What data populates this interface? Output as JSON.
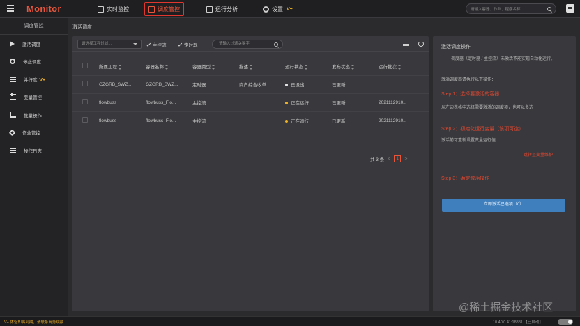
{
  "app": {
    "title": "Monitor"
  },
  "topnav": {
    "items": [
      {
        "label": "实时监控",
        "active": false
      },
      {
        "label": "调度管控",
        "active": true
      },
      {
        "label": "运行分析",
        "active": false
      },
      {
        "label": "设置",
        "badge": "V+",
        "active": false
      }
    ],
    "search_placeholder": "请输入容器、作业、程序名称"
  },
  "sidebar": {
    "title": "调度管控",
    "items": [
      {
        "label": "激活调度",
        "icon": "play-icon"
      },
      {
        "label": "停止调度",
        "icon": "stop-icon"
      },
      {
        "label": "并行度",
        "badge": "V+",
        "icon": "parallel-icon"
      },
      {
        "label": "变量管控",
        "icon": "sliders-icon"
      },
      {
        "label": "批量操作",
        "icon": "batch-icon"
      },
      {
        "label": "作业管控",
        "icon": "tool-icon"
      },
      {
        "label": "操作日志",
        "icon": "log-icon"
      }
    ]
  },
  "main": {
    "breadcrumb": "激活调度",
    "filters": {
      "project_select_placeholder": "请选择工程过滤...",
      "check_main": "主控流",
      "check_timer": "定时器",
      "keyword_placeholder": "请输入过滤关键字"
    },
    "table": {
      "columns": [
        "所属工程",
        "容器名称",
        "容器类型",
        "描述",
        "运行状态",
        "发布状态",
        "运行批次"
      ],
      "rows": [
        {
          "project": "GZGRB_SWZ...",
          "container": "GZGRB_SWZ...",
          "type": "定时器",
          "desc": "商户综合收单...",
          "run_state": "已退出",
          "run_color": "#e6e6e6",
          "publish": "已更新",
          "batch": ""
        },
        {
          "project": "flowbuss",
          "container": "flowbuss_Flo...",
          "type": "主控流",
          "desc": "",
          "run_state": "正在运行",
          "run_color": "#f0b323",
          "publish": "已更新",
          "batch": "2021112910..."
        },
        {
          "project": "flowbuss",
          "container": "flowbuss_Flo...",
          "type": "主控流",
          "desc": "",
          "run_state": "正在运行",
          "run_color": "#f0b323",
          "publish": "已更新",
          "batch": "2021112910..."
        }
      ]
    },
    "pager": {
      "total": "共 3 条",
      "prev": "<",
      "current": "1",
      "next": ">"
    }
  },
  "right_panel": {
    "title": "激活调度操作",
    "intro": "调度器（定时器 / 主控流）未激活不能实现自动化运行。",
    "instruction": "激活调度器请执行以下操作：",
    "step1": "Step 1：选择要激活的容器",
    "step1_text": "从左边表格中选择需要激活的调度项，也可以多选",
    "step2": "Step 2：初始化运行变量（该项可选）",
    "step2_text": "激活前可重新设置变量运行值",
    "step2_link": "跳转至变量维护",
    "step3": "Step 3：确定激活操作",
    "button": "立即激活已选项（0）"
  },
  "statusbar": {
    "left": "V+ 体验即将到期，请联系商务续期",
    "right": "10.40.0.41:18881 【已启动】"
  },
  "watermark": "@稀土掘金技术社区",
  "colors": {
    "accent": "#e8553b",
    "primary_button": "#3f7fbd",
    "running": "#f0b323",
    "vplus": "#f0b323"
  }
}
